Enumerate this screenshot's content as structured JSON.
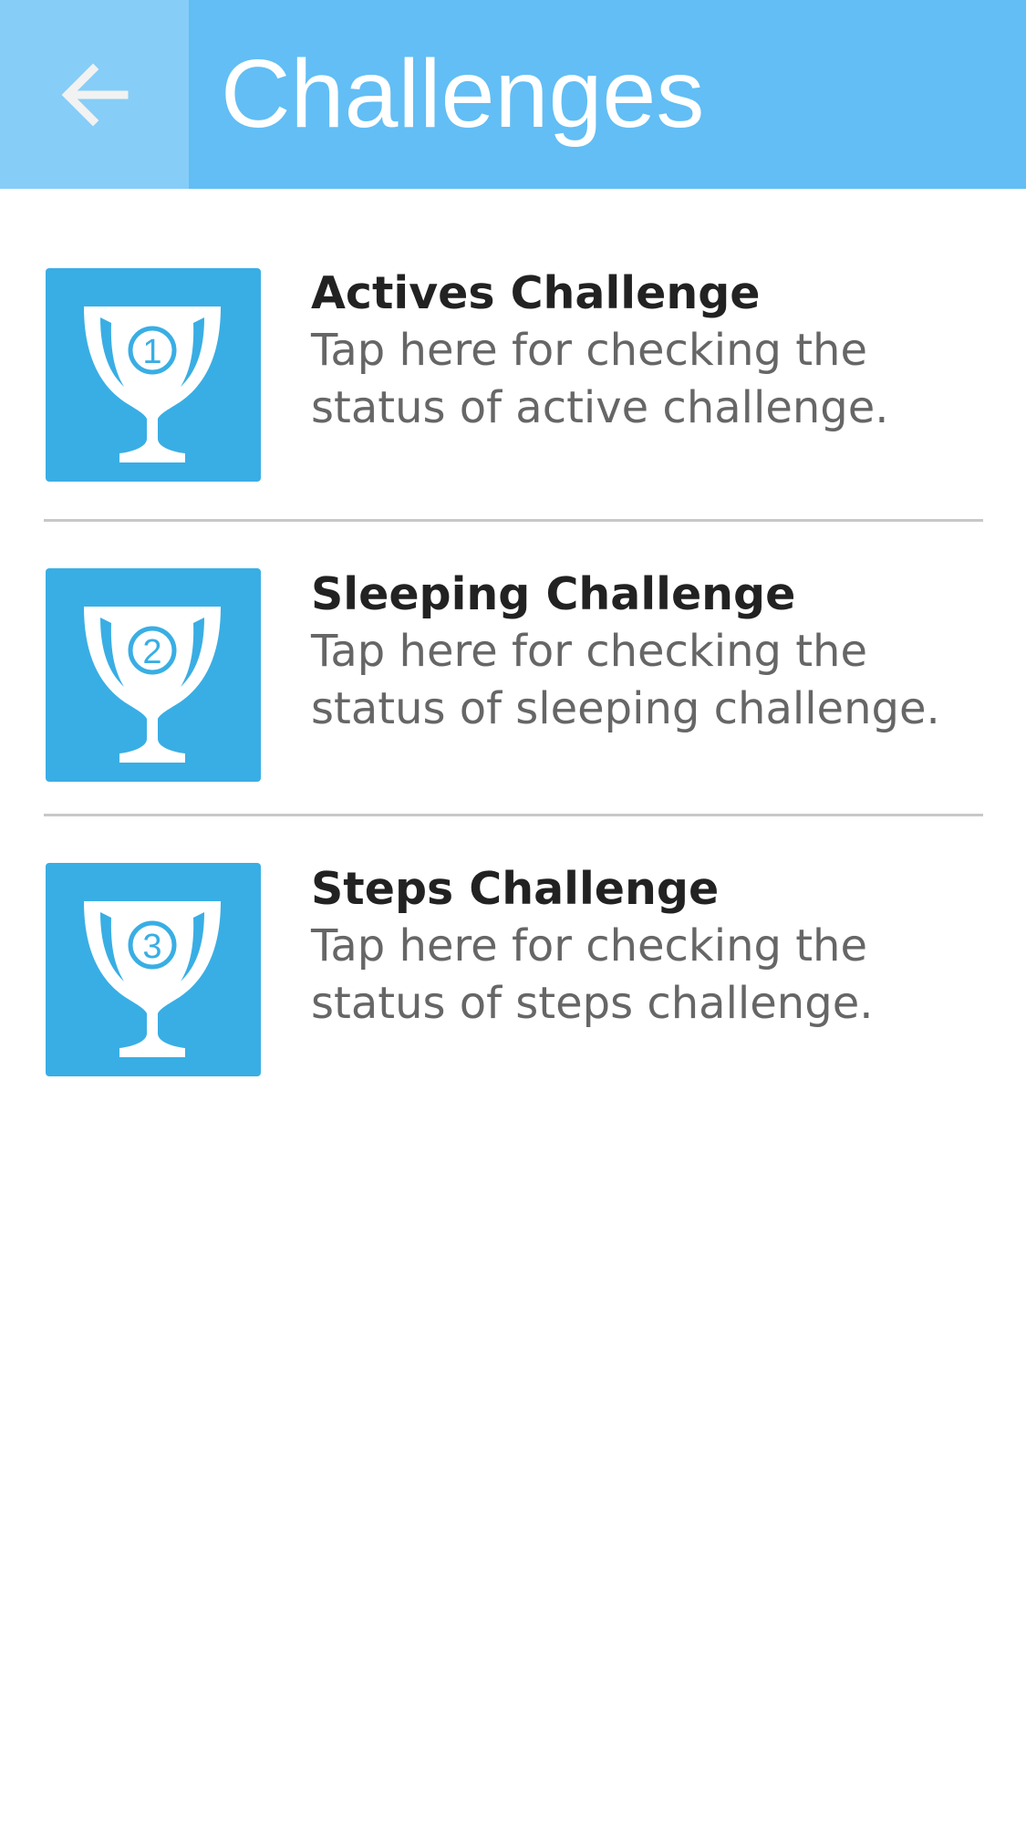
{
  "app_bar": {
    "title": "Challenges",
    "back_icon": "arrow-left-icon",
    "color": "#62bef4",
    "back_area_color": "#86cdf7"
  },
  "challenges": [
    {
      "title": "Actives Challenge",
      "description_line1": "Tap here for checking the",
      "description_line2": "status of active challenge.",
      "icon": "trophy-icon",
      "badge_number": "1"
    },
    {
      "title": "Sleeping Challenge",
      "description_line1": "Tap here for checking the",
      "description_line2": "status of sleeping challenge.",
      "icon": "trophy-icon",
      "badge_number": "2"
    },
    {
      "title": "Steps Challenge",
      "description_line1": "Tap here for checking the",
      "description_line2": "status of steps challenge.",
      "icon": "trophy-icon",
      "badge_number": "3"
    }
  ],
  "colors": {
    "icon_tile": "#39aee4",
    "title_text": "#222222",
    "description_text": "#666666",
    "divider": "#c8c8c8"
  }
}
